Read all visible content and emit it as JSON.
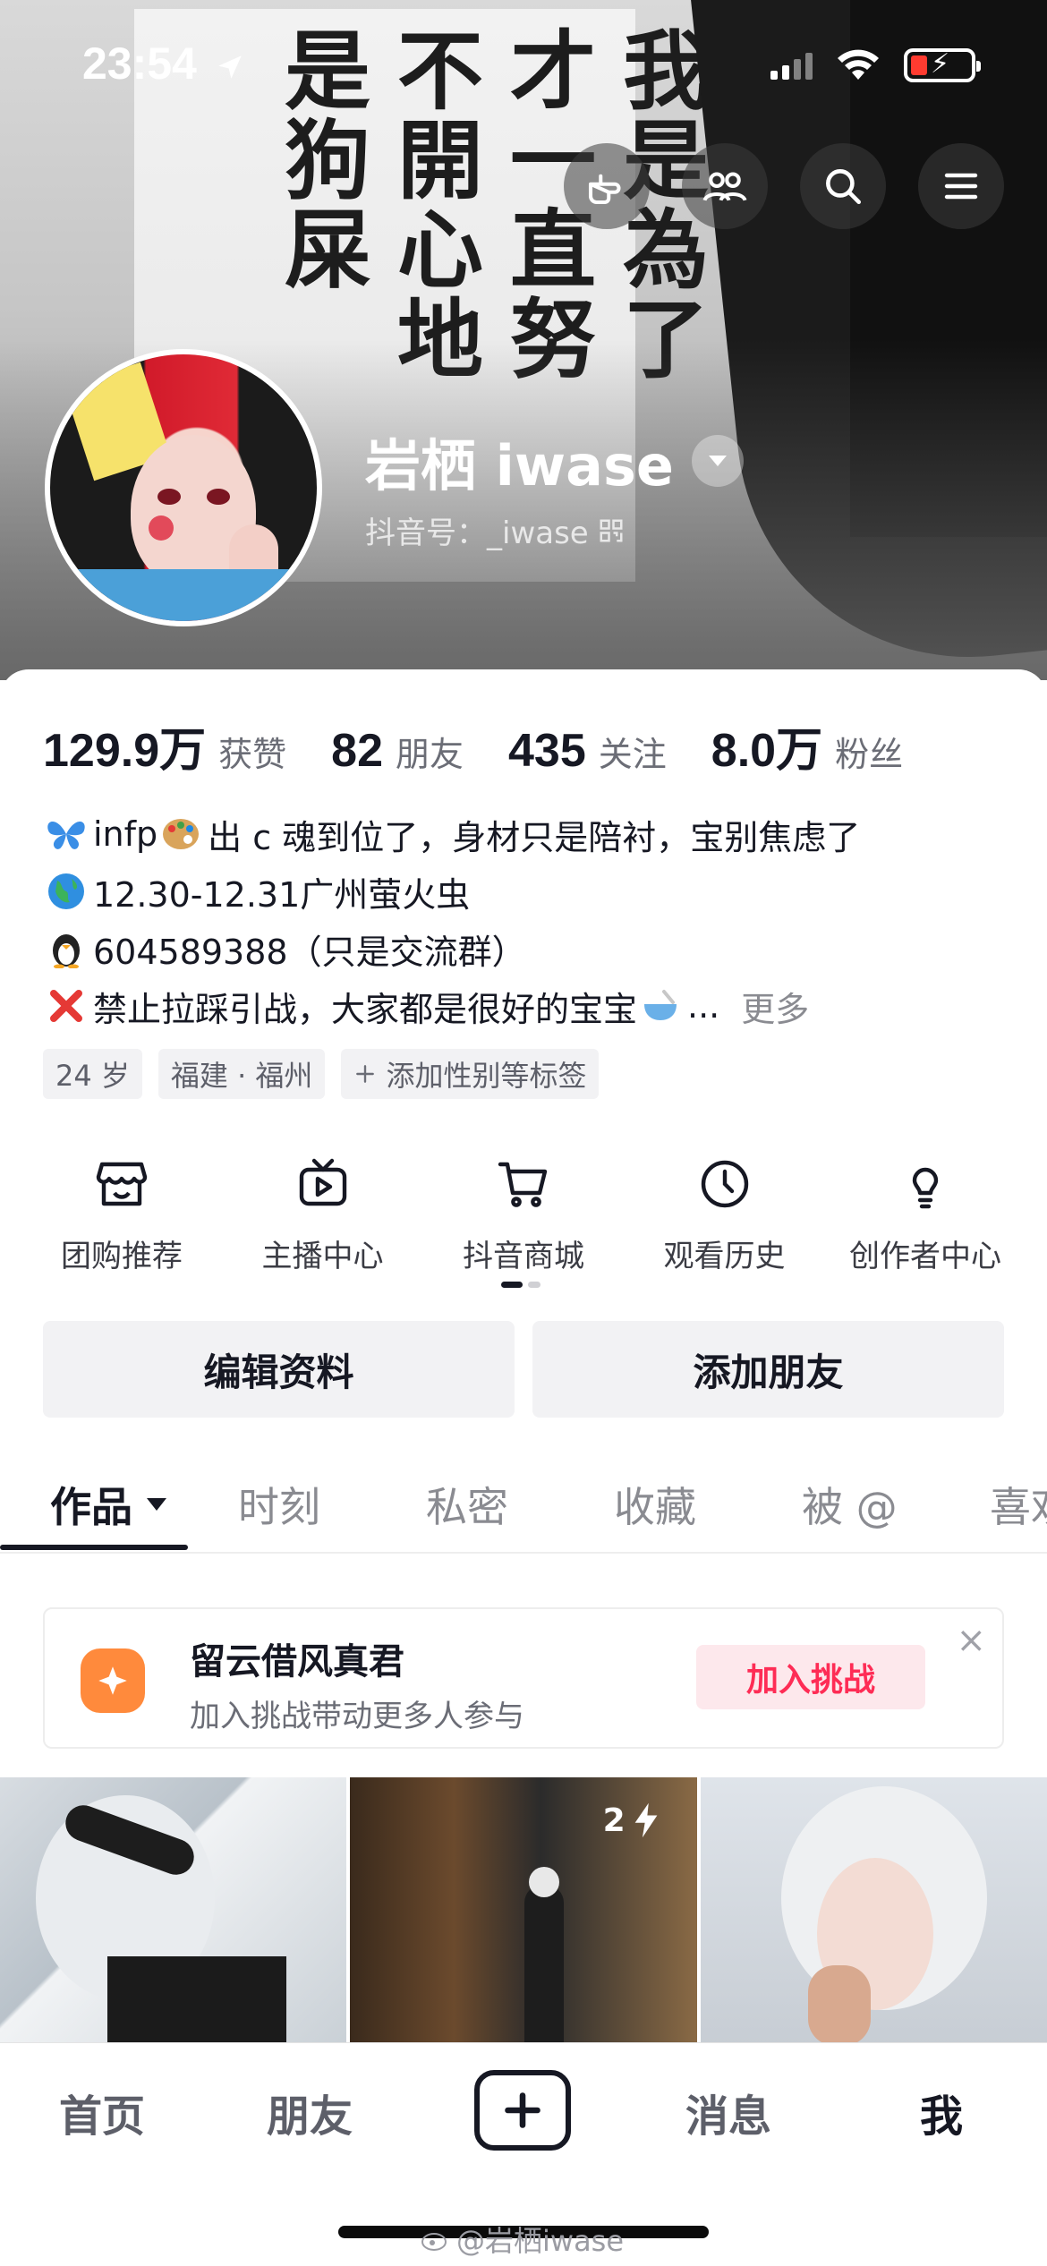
{
  "status_bar": {
    "time": "23:54"
  },
  "cover": {
    "manga_columns": [
      "我是為了",
      "才一直努",
      "不開心地",
      "是狗屎"
    ]
  },
  "profile": {
    "name": "岩栖 iwase",
    "douyin_id": "抖音号：_iwase"
  },
  "stats": [
    {
      "value": "129.9万",
      "label": "获赞"
    },
    {
      "value": "82",
      "label": "朋友"
    },
    {
      "value": "435",
      "label": "关注"
    },
    {
      "value": "8.0万",
      "label": "粉丝"
    }
  ],
  "bio": {
    "line1_text": "infp",
    "line1_rest": "出 c 魂到位了，身材只是陪衬，宝别焦虑了",
    "line2": "12.30-12.31广州萤火虫",
    "line3": " 604589388（只是交流群）",
    "line4": "禁止拉踩引战，大家都是很好的宝宝",
    "line4_ellipsis": "...",
    "more": "更多"
  },
  "tags": [
    "24 岁",
    "福建 · 福州",
    "添加性别等标签"
  ],
  "services": [
    {
      "label": "团购推荐",
      "icon": "shop-icon"
    },
    {
      "label": "主播中心",
      "icon": "tv-play-icon"
    },
    {
      "label": "抖音商城",
      "icon": "cart-icon"
    },
    {
      "label": "观看历史",
      "icon": "clock-icon"
    },
    {
      "label": "创作者中心",
      "icon": "lightbulb-icon"
    }
  ],
  "buttons": {
    "edit_profile": "编辑资料",
    "add_friend": "添加朋友"
  },
  "tabs": [
    "作品",
    "时刻",
    "私密",
    "收藏",
    "被 @",
    "喜欢"
  ],
  "challenge": {
    "title": "留云借风真君",
    "subtitle": "加入挑战带动更多人参与",
    "join": "加入挑战",
    "close": "×"
  },
  "grid": {
    "badge_count": "2"
  },
  "bottom_nav": {
    "home": "首页",
    "friends": "朋友",
    "messages": "消息",
    "me": "我"
  },
  "watermark": "@岩栖iwase",
  "colors": {
    "accent": "#fe2c55",
    "challenge_orange": "#ff8a3c",
    "battery_low": "#ff3b30"
  }
}
